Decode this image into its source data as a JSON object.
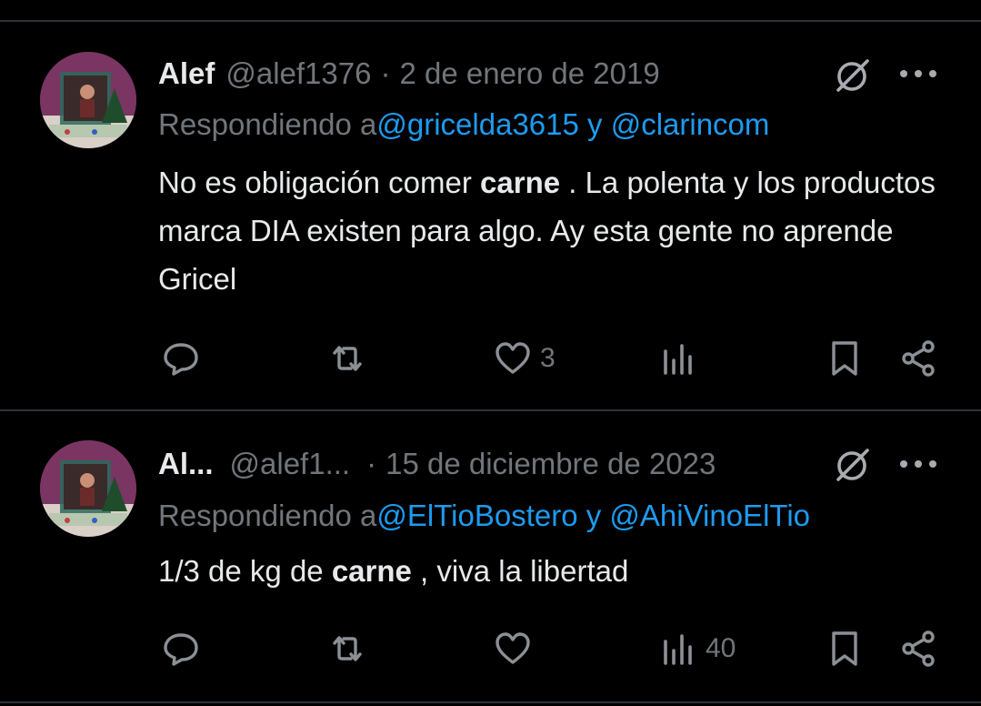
{
  "colors": {
    "background": "#000000",
    "text_primary": "#e7e9ea",
    "text_secondary": "#71767b",
    "link": "#1d9bf0",
    "divider": "#2f3336"
  },
  "tweets": [
    {
      "name": "Alef",
      "handle": "@alef1376",
      "separator": "·",
      "date": "2 de enero de 2019",
      "replying_prefix": "Respondiendo a",
      "replying_handle_1": "@gricelda3615",
      "replying_conjunction": " y ",
      "replying_handle_2": "@clarincom",
      "text_before": "No es obligación comer ",
      "text_bold": "carne",
      "text_after": " . La polenta y los productos marca DIA existen para algo. Ay esta gente no aprende Gricel",
      "actions": {
        "reply_count": "",
        "retweet_count": "",
        "like_count": "3",
        "views_count": ""
      },
      "icons": [
        "avatar",
        "grok-icon",
        "more-icon",
        "reply-icon",
        "retweet-icon",
        "like-icon",
        "views-icon",
        "bookmark-icon",
        "share-icon"
      ]
    },
    {
      "name": "Al...",
      "handle": "@alef1...",
      "separator": "·",
      "date": "15 de diciembre de 2023",
      "replying_prefix": "Respondiendo a",
      "replying_handle_1": "@ElTioBostero",
      "replying_conjunction": " y ",
      "replying_handle_2": "@AhiVinoElTio",
      "text_before": "1/3 de kg de ",
      "text_bold": "carne",
      "text_after": " , viva la libertad",
      "actions": {
        "reply_count": "",
        "retweet_count": "",
        "like_count": "",
        "views_count": "40"
      },
      "icons": [
        "avatar",
        "grok-icon",
        "more-icon",
        "reply-icon",
        "retweet-icon",
        "like-icon",
        "views-icon",
        "bookmark-icon",
        "share-icon"
      ]
    }
  ]
}
